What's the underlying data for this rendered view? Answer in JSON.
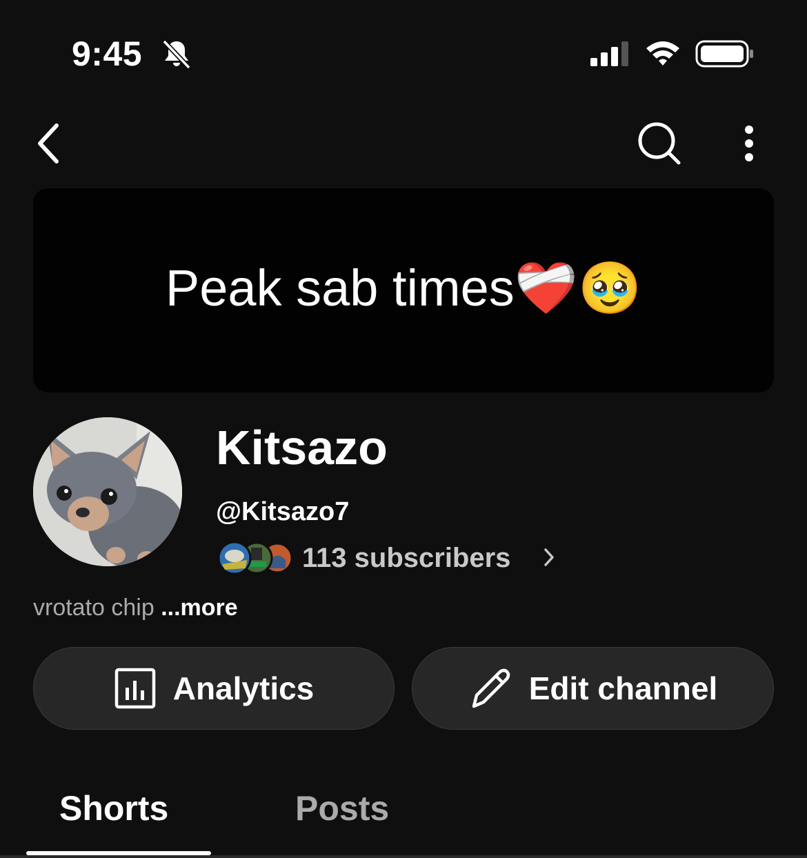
{
  "status_bar": {
    "time": "9:45",
    "icons": [
      "bell-slash-icon",
      "cellular-signal-icon",
      "wifi-icon",
      "battery-icon"
    ]
  },
  "nav": {
    "icons": [
      "back-chevron-icon",
      "search-icon",
      "more-vertical-icon"
    ]
  },
  "banner": {
    "text": "Peak sab times❤️‍🩹🥹",
    "background": "#020202"
  },
  "channel": {
    "name": "Kitsazo",
    "handle": "@Kitsazo7",
    "subscribers": "113 subscribers",
    "description": "vrotato chip",
    "more_label": "...more"
  },
  "actions": {
    "analytics_label": "Analytics",
    "edit_label": "Edit channel"
  },
  "tabs": [
    {
      "label": "Shorts",
      "active": true
    },
    {
      "label": "Posts",
      "active": false
    }
  ],
  "colors": {
    "background": "#0f0f0f",
    "button_bg": "#272727",
    "muted_text": "#aaaaaa"
  }
}
